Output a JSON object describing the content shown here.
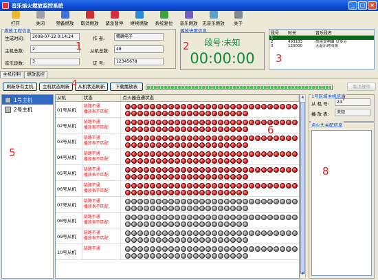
{
  "window": {
    "title": "音乐焰火燃放监控系统",
    "controls": [
      "_",
      "□",
      "×"
    ]
  },
  "toolbar": [
    {
      "label": "打开",
      "icon": "folder-open-icon",
      "color": "#e8b830"
    },
    {
      "label": "关闭",
      "icon": "close-file-icon",
      "color": "#9aa0a8"
    },
    {
      "label": "预备燃放",
      "icon": "prepare-icon",
      "color": "#4070d0"
    },
    {
      "label": "取消燃放",
      "icon": "cancel-icon",
      "color": "#d03030"
    },
    {
      "label": "紧急暂停",
      "icon": "emergency-stop-icon",
      "color": "#d83040"
    },
    {
      "label": "继续燃放",
      "icon": "resume-icon",
      "color": "#2a8ad8"
    },
    {
      "label": "系统复位",
      "icon": "reset-icon",
      "color": "#40a040"
    },
    {
      "label": "音乐燃放",
      "icon": "music-fire-icon",
      "color": "#7060c0"
    },
    {
      "label": "无音乐燃放",
      "icon": "no-music-fire-icon",
      "color": "#60a0c0"
    },
    {
      "label": "关于",
      "icon": "about-icon",
      "color": "#808890"
    }
  ],
  "project": {
    "title": "燃放工程信息",
    "gen_time_label": "生成时间:",
    "gen_time": "2008-07-22 0:14:24",
    "author_label": "作 者:",
    "author": "精确电子",
    "host_count_label": "主机总数:",
    "host_count": "2",
    "slave_count_label": "从机总数:",
    "slave_count": "48",
    "music_count_label": "音乐段数:",
    "music_count": "3",
    "cert_label": "证 号:",
    "cert": "12345678"
  },
  "playback": {
    "title": "播放进度信息",
    "segment": "段号:未知",
    "time": "00:00:00"
  },
  "songs": {
    "headers": [
      "段号",
      "时长",
      "音乐段名"
    ],
    "rows": [
      [
        "1",
        "",
        ""
      ],
      [
        "2",
        "493183",
        "命运交响曲 贝多芬"
      ],
      [
        "3",
        "120000",
        "无音乐时间段"
      ]
    ]
  },
  "tabs": [
    "主机控制",
    "燃放监控"
  ],
  "buttons": {
    "refresh_all": "刷新所有主机",
    "host_status": "主机状态刷新",
    "slave_status": "从机状态刷新",
    "download": "下载播放表",
    "cancel_op": "取消操作"
  },
  "progress": {
    "fraction": 1.0
  },
  "hosts": [
    "1号主机",
    "2号主机"
  ],
  "grid": {
    "headers": [
      "从机",
      "状态",
      "点火器连通状态"
    ],
    "rows": [
      {
        "name": "01号从机",
        "s1": "链路不通",
        "s2": "播放表不匹配",
        "on": 48
      },
      {
        "name": "02号从机",
        "s1": "链路不通",
        "s2": "播放表不匹配",
        "on": 48
      },
      {
        "name": "03号从机",
        "s1": "链路不通",
        "s2": "播放表不匹配",
        "on": 48
      },
      {
        "name": "04号从机",
        "s1": "链路不通",
        "s2": "播放表不匹配",
        "on": 48
      },
      {
        "name": "05号从机",
        "s1": "链路不通",
        "s2": "播放表不匹配",
        "on": 48
      },
      {
        "name": "06号从机",
        "s1": "链路不通",
        "s2": "播放表不匹配",
        "on": 48
      },
      {
        "name": "07号从机",
        "s1": "链路不通",
        "s2": "播放表不匹配",
        "on": 0
      },
      {
        "name": "08号从机",
        "s1": "链路不通",
        "s2": "播放表不匹配",
        "on": 0
      },
      {
        "name": "09号从机",
        "s1": "链路不通",
        "s2": "播放表不匹配",
        "on": 0
      },
      {
        "name": "10号从机",
        "s1": "链路不通",
        "s2": "",
        "on": 0
      }
    ]
  },
  "slave_info": {
    "title": "1号区域主机信息",
    "slave_no_label": "从 机 号:",
    "slave_no": "24",
    "table_label": "播 放 表:",
    "table": "未知"
  },
  "igniter": {
    "title": "点火头关配信息"
  },
  "annotations": [
    "1",
    "2",
    "3",
    "4",
    "5",
    "6",
    "7",
    "8"
  ]
}
